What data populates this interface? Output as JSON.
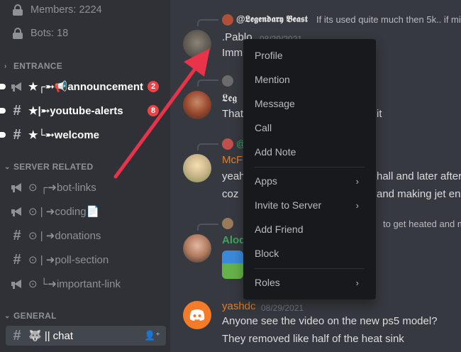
{
  "sidebar": {
    "members_label": "Members: 2224",
    "bots_label": "Bots: 18",
    "categories": {
      "entrance": "ENTRANCE",
      "server_related": "SERVER RELATED",
      "general": "GENERAL"
    },
    "channels": {
      "announcement": {
        "prefix": "★┌➵📢",
        "label": "announcement",
        "badge": "2"
      },
      "youtube": {
        "prefix": "★|➵",
        "label": "youtube-alerts",
        "badge": "8"
      },
      "welcome": {
        "prefix": "★└➵",
        "label": "welcome"
      },
      "bot_links": {
        "prefix": "⊙ ┌➜",
        "label": "bot-links"
      },
      "coding": {
        "prefix": "⊙ | ➜",
        "label": "coding📄"
      },
      "donations": {
        "prefix": "⊙ | ➜",
        "label": "donations"
      },
      "poll": {
        "prefix": "⊙ | ➜",
        "label": "poll-section"
      },
      "important": {
        "prefix": "⊙ └➜",
        "label": "important-link"
      },
      "chat": {
        "prefix": "🐺 ||",
        "label": "chat"
      }
    }
  },
  "messages": {
    "m1": {
      "reply_user": "@𝕷𝖊𝖌𝖊𝖓𝖉𝖆𝖗𝖞 𝕭𝖊𝖆𝖘𝖙",
      "reply_text": "If its used quite much then 5k.. if mi",
      "author": ".Pablo",
      "timestamp": "08/29/2021",
      "text": "Imm"
    },
    "m2": {
      "author": "𝕷𝖊𝖌",
      "text_left": "That",
      "text_right": "it"
    },
    "m3": {
      "reply_user": "@",
      "author": "McF",
      "line1_left": "yeah",
      "line1_right": "hall and later after",
      "line2_left": "coz",
      "line2_right": "and making jet eng"
    },
    "m4": {
      "reply_text": "to get heated and ma",
      "author": "Alod"
    },
    "m5": {
      "author": "yashdc",
      "timestamp": "08/29/2021",
      "line1": "Anyone see the video on the new ps5 model?",
      "line2": "They removed like half of the heat sink"
    }
  },
  "context_menu": {
    "items": {
      "profile": "Profile",
      "mention": "Mention",
      "message": "Message",
      "call": "Call",
      "add_note": "Add Note",
      "apps": "Apps",
      "invite": "Invite to Server",
      "add_friend": "Add Friend",
      "block": "Block",
      "roles": "Roles"
    },
    "submenu_glyph": "›"
  },
  "icons": {
    "lock": "lock-icon",
    "hash": "#",
    "chevron_right": "›",
    "chevron_down": "⌄",
    "add_user": "👤⁺"
  },
  "colors": {
    "sidebar_bg": "#2f3136",
    "chat_bg": "#36393f",
    "menu_bg": "#18191c",
    "badge_red": "#ed4245",
    "arrow_red": "#e8334a",
    "username_orange": "#e67e22",
    "username_green": "#3ba55d",
    "discord_orange": "#f47b27"
  }
}
